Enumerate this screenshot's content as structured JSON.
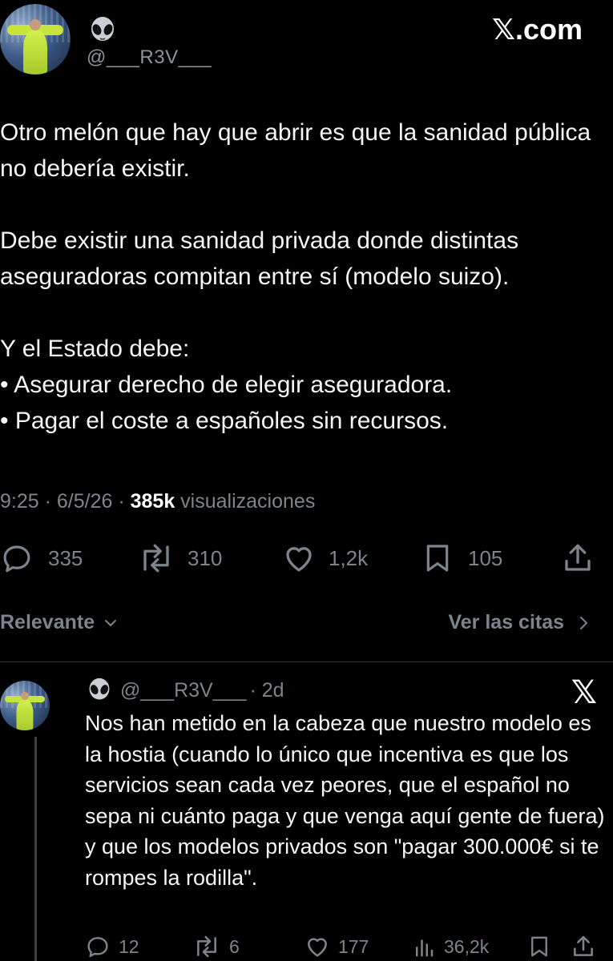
{
  "header": {
    "emoji": "👽",
    "handle": "@___R3V___",
    "brand": "𝕏.com"
  },
  "tweet": {
    "paragraphs": [
      "Otro melón que hay que abrir es que la sanidad pública no debería existir.",
      "Debe existir una sanidad privada donde distintas aseguradoras compitan entre sí (modelo suizo).",
      "Y el Estado debe:"
    ],
    "bullets": [
      "• Asegurar derecho de elegir aseguradora.",
      "• Pagar el coste a españoles sin recursos."
    ],
    "time": "9:25 · 6/5/26 · ",
    "views_count": "385k",
    "views_label": " visualizaciones",
    "replies": "335",
    "retweets": "310",
    "likes": "1,2k",
    "bookmarks": "105"
  },
  "sort": {
    "left_label": "Relevante",
    "right_label": "Ver las citas"
  },
  "reply": {
    "handle": "@___R3V___",
    "time": "· 2d",
    "text": "Nos han metido en la cabeza que nuestro modelo es la hostia (cuando lo único que incentiva es que los servicios sean cada vez peores, que el español no sepa ni cuánto paga y que venga aquí gente de fuera) y que los modelos privados son \"pagar 300.000€ si te rompes la rodilla\".",
    "x_logo": "𝕏",
    "replies": "12",
    "retweets": "6",
    "likes": "177",
    "views": "36,2k"
  },
  "colors": {
    "background": "#000000",
    "text": "#f4f5f6",
    "muted": "#7d848b",
    "divider": "#2f3336"
  }
}
